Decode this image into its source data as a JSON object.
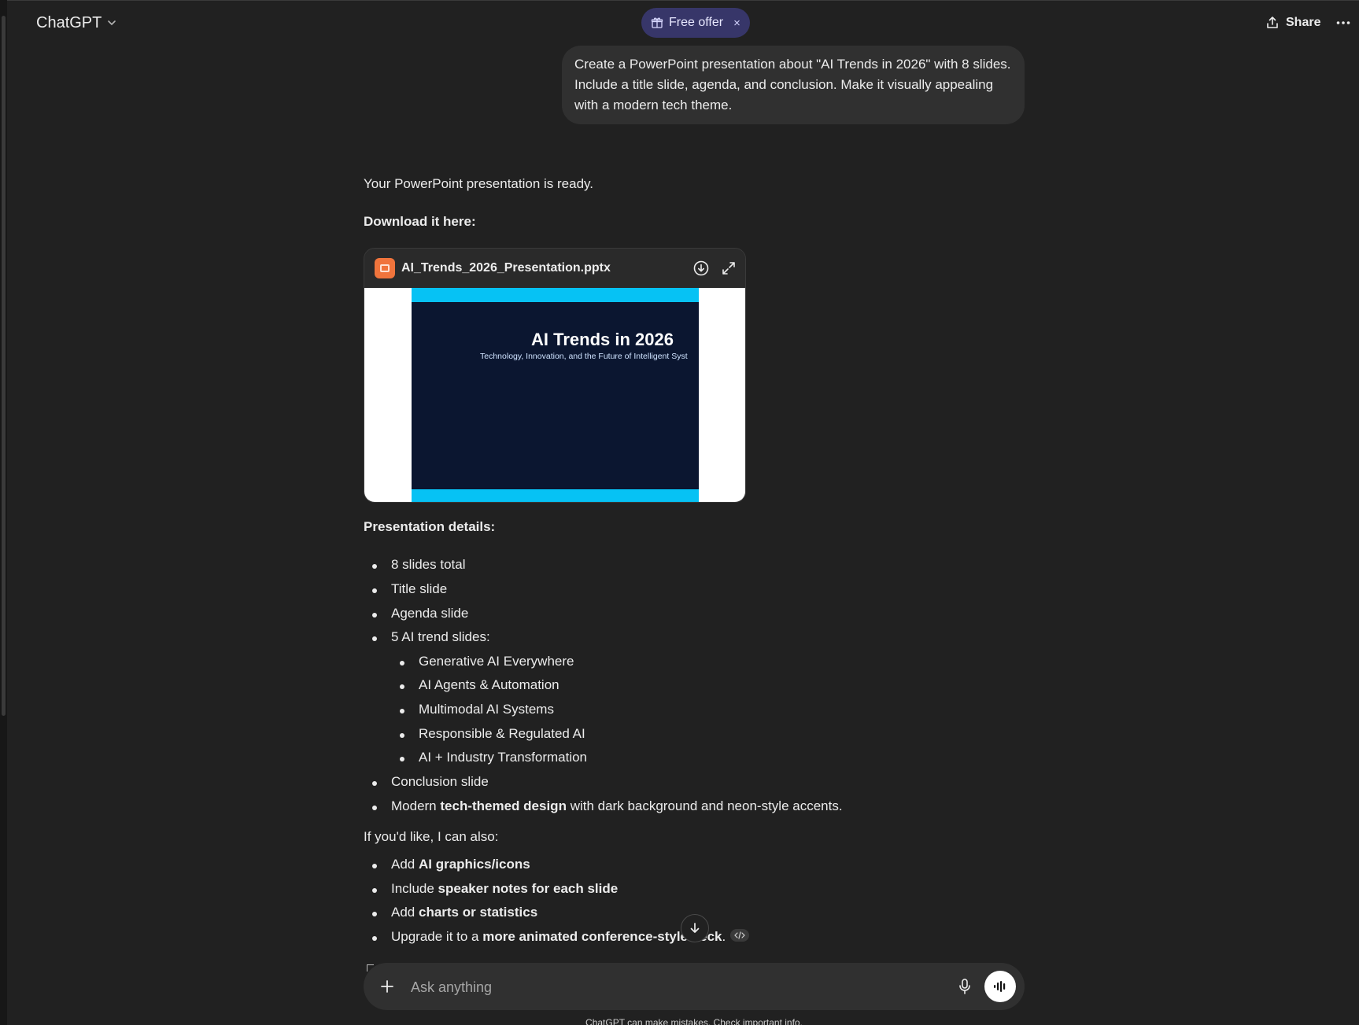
{
  "header": {
    "model_label": "ChatGPT",
    "free_offer_label": "Free offer",
    "free_offer_close": "×",
    "share_label": "Share"
  },
  "user_message": "Create a PowerPoint presentation about \"AI Trends in 2026\" with 8 slides. Include a title slide, agenda, and conclusion. Make it visually appealing with a modern tech theme.",
  "assistant": {
    "ready_text": "Your PowerPoint presentation is ready.",
    "download_heading": "Download it here:",
    "file": {
      "name": "AI_Trends_2026_Presentation.pptx",
      "preview_title": "AI Trends in 2026",
      "preview_subtitle": "Technology, Innovation, and the Future of Intelligent Syst"
    },
    "details_heading": "Presentation details:",
    "details": [
      "8 slides total",
      "Title slide",
      "Agenda slide",
      "5 AI trend slides:"
    ],
    "trend_slides": [
      "Generative AI Everywhere",
      "AI Agents & Automation",
      "Multimodal AI Systems",
      "Responsible & Regulated AI",
      "AI + Industry Transformation"
    ],
    "conclusion_item": "Conclusion slide",
    "design_item": {
      "pre": "Modern ",
      "bold": "tech-themed design",
      "post": " with dark background and neon-style accents."
    },
    "offer_intro": "If you'd like, I can also:",
    "offers": [
      {
        "pre": "Add ",
        "bold": "AI graphics/icons",
        "post": ""
      },
      {
        "pre": "Include ",
        "bold": "speaker notes for each slide",
        "post": ""
      },
      {
        "pre": "Add ",
        "bold": "charts or statistics",
        "post": ""
      },
      {
        "pre": "Upgrade it to a ",
        "bold": "more animated conference-style deck",
        "post": "."
      }
    ]
  },
  "composer": {
    "placeholder": "Ask anything"
  },
  "disclaimer": "ChatGPT can make mistakes. Check important info."
}
